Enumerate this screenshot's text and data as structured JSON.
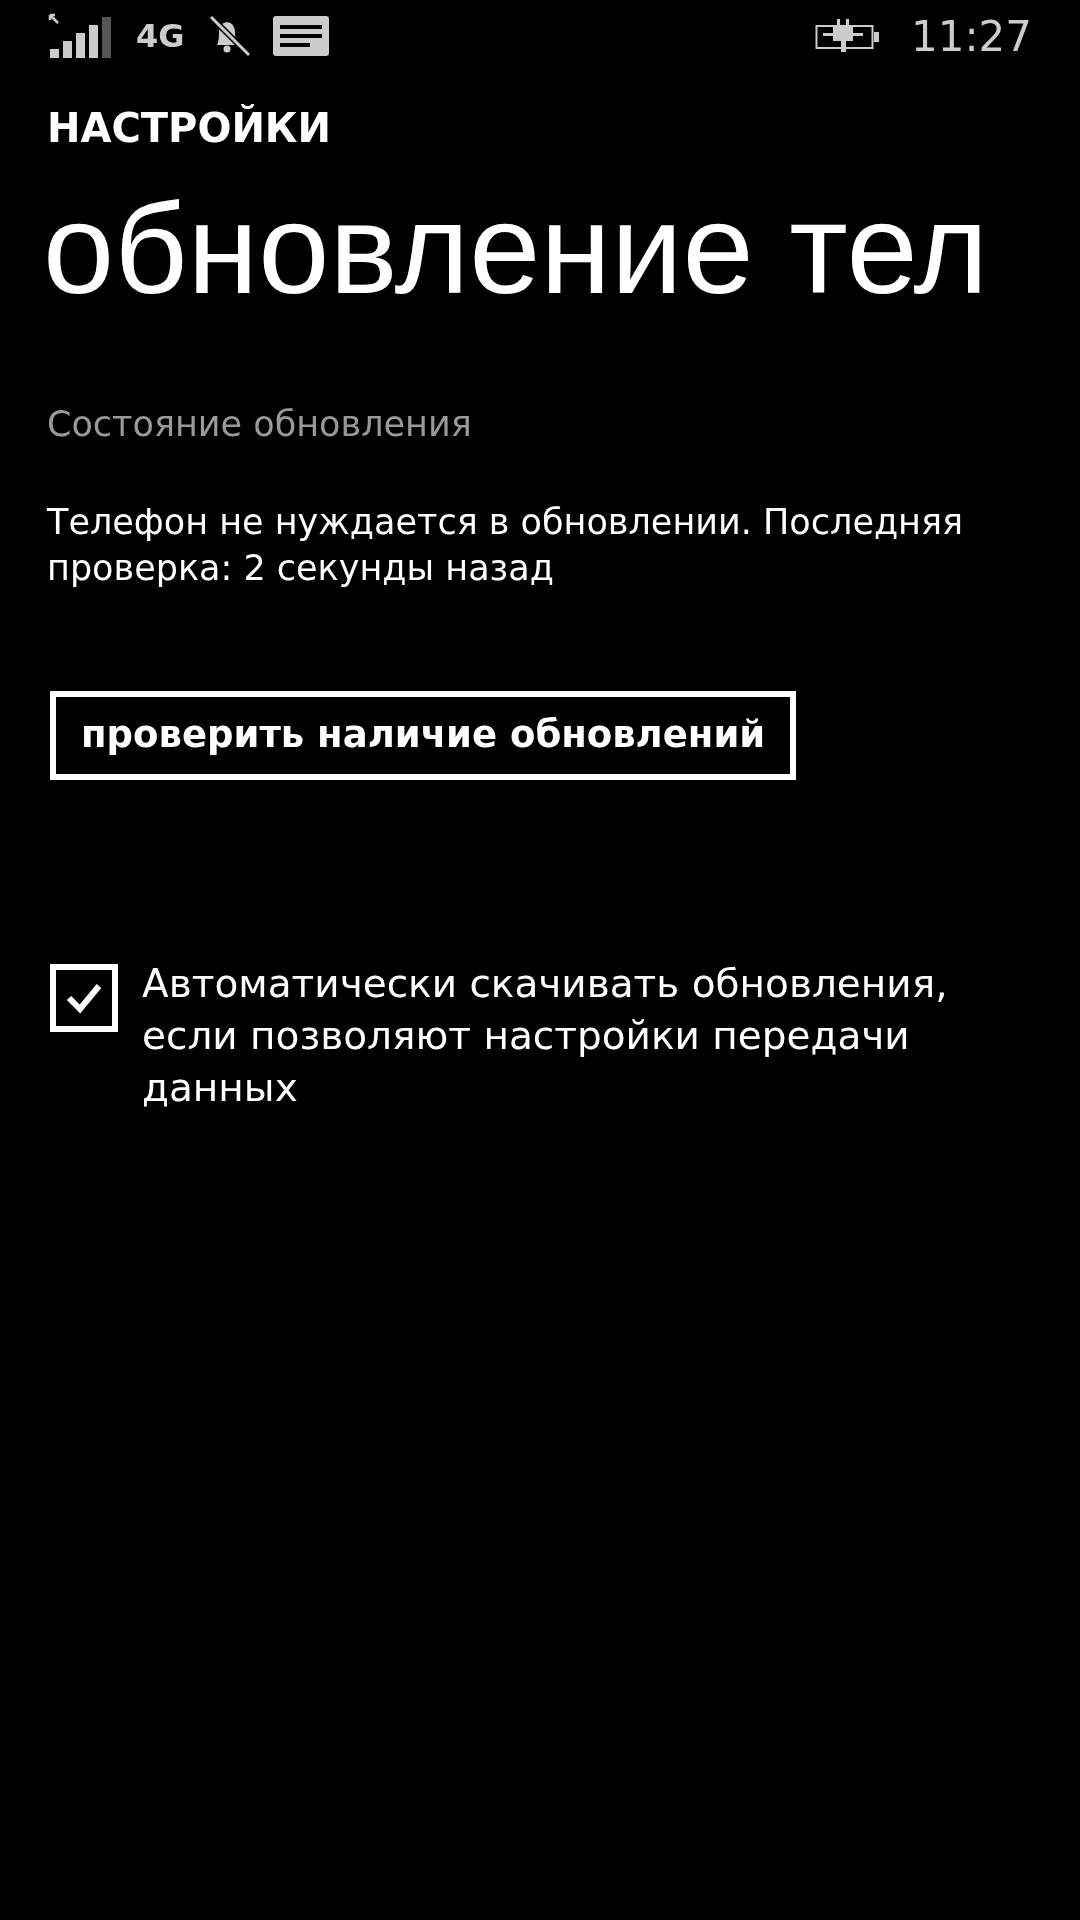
{
  "status_bar": {
    "network": "4G",
    "time": "11:27"
  },
  "header": {
    "app_title": "НАСТРОЙКИ",
    "page_title": "обновление тел"
  },
  "section_label": "Состояние обновления",
  "status_text": "Телефон не нуждается в обновлении. Последняя проверка: 2 секунды назад",
  "check_button": "проверить наличие обновлений",
  "auto_download": {
    "label": "Автоматически скачивать обновления, если позволяют настройки передачи данных",
    "checked": true
  }
}
